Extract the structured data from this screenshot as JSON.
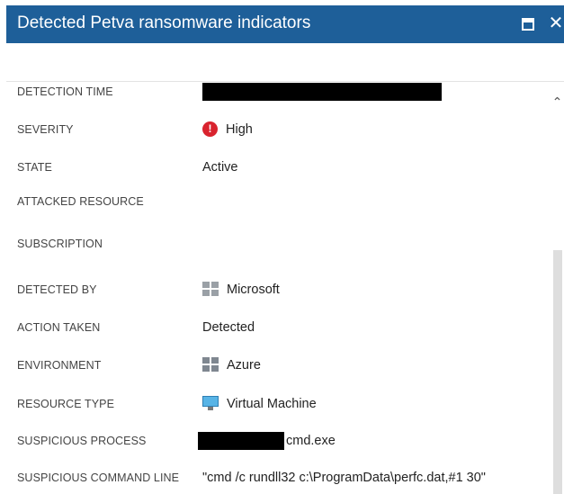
{
  "window": {
    "title": "Detected Petva ransomware indicators"
  },
  "icons": {
    "maximize": "maximize-icon",
    "close": "close-icon",
    "severity": "alert-circle-icon",
    "detected_by": "windows-logo-icon",
    "environment": "windows-logo-icon",
    "resource_type": "monitor-icon",
    "scroll_up": "chevron-up-icon"
  },
  "glyphs": {
    "close": "✕",
    "severity": "!",
    "scroll_up": "⌃"
  },
  "colors": {
    "titlebar": "#1e5f99",
    "severity_high": "#d9232e",
    "redaction": "#000000"
  },
  "details": {
    "detection_time": {
      "label": "DETECTION TIME",
      "value": ""
    },
    "severity": {
      "label": "SEVERITY",
      "value": "High"
    },
    "state": {
      "label": "STATE",
      "value": "Active"
    },
    "attacked_resource": {
      "label": "ATTACKED RESOURCE",
      "value": ""
    },
    "subscription": {
      "label": "SUBSCRIPTION",
      "value": ""
    },
    "detected_by": {
      "label": "DETECTED BY",
      "value": "Microsoft"
    },
    "action_taken": {
      "label": "ACTION TAKEN",
      "value": "Detected"
    },
    "environment": {
      "label": "ENVIRONMENT",
      "value": "Azure"
    },
    "resource_type": {
      "label": "RESOURCE TYPE",
      "value": "Virtual Machine"
    },
    "suspicious_process": {
      "label": "SUSPICIOUS PROCESS",
      "value": "cmd.exe"
    },
    "suspicious_command_line": {
      "label": "SUSPICIOUS COMMAND LINE",
      "value": "\"cmd  /c rundll32 c:\\ProgramData\\perfc.dat,#1 30\""
    }
  }
}
